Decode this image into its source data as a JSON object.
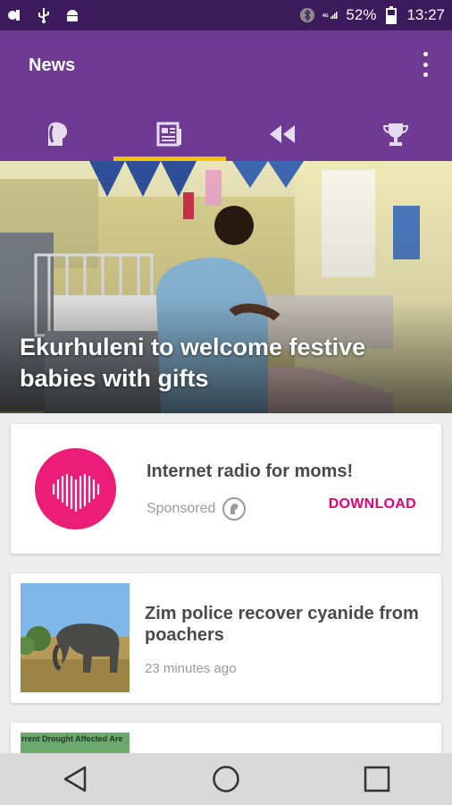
{
  "status_bar": {
    "battery": "52%",
    "time": "13:27",
    "icons": [
      "notification-icon",
      "usb-icon",
      "android-icon",
      "bluetooth-icon",
      "signal-icon",
      "battery-icon"
    ]
  },
  "app_bar": {
    "title": "News",
    "menu_icon": "more-vert-icon",
    "tabs": [
      {
        "icon": "head-icon",
        "active": false
      },
      {
        "icon": "newspaper-icon",
        "active": true
      },
      {
        "icon": "rewind-icon",
        "active": false
      },
      {
        "icon": "trophy-icon",
        "active": false
      }
    ],
    "colors": {
      "primary": "#6e3a94",
      "status": "#3d1a5b",
      "indicator": "#f5c400"
    }
  },
  "hero": {
    "headline": "Ekurhuleni to welcome festive babies with gifts"
  },
  "ad": {
    "title": "Internet radio for moms!",
    "sponsored": "Sponsored",
    "cta": "DOWNLOAD",
    "accent": "#e4007c"
  },
  "articles": [
    {
      "title": "Zim police recover cyanide from poachers",
      "time": "23 minutes ago"
    },
    {
      "thumb_text": "rrent Drought Affected Are"
    }
  ],
  "nav_bar": {
    "buttons": [
      "back-icon",
      "home-icon",
      "recents-icon"
    ]
  }
}
